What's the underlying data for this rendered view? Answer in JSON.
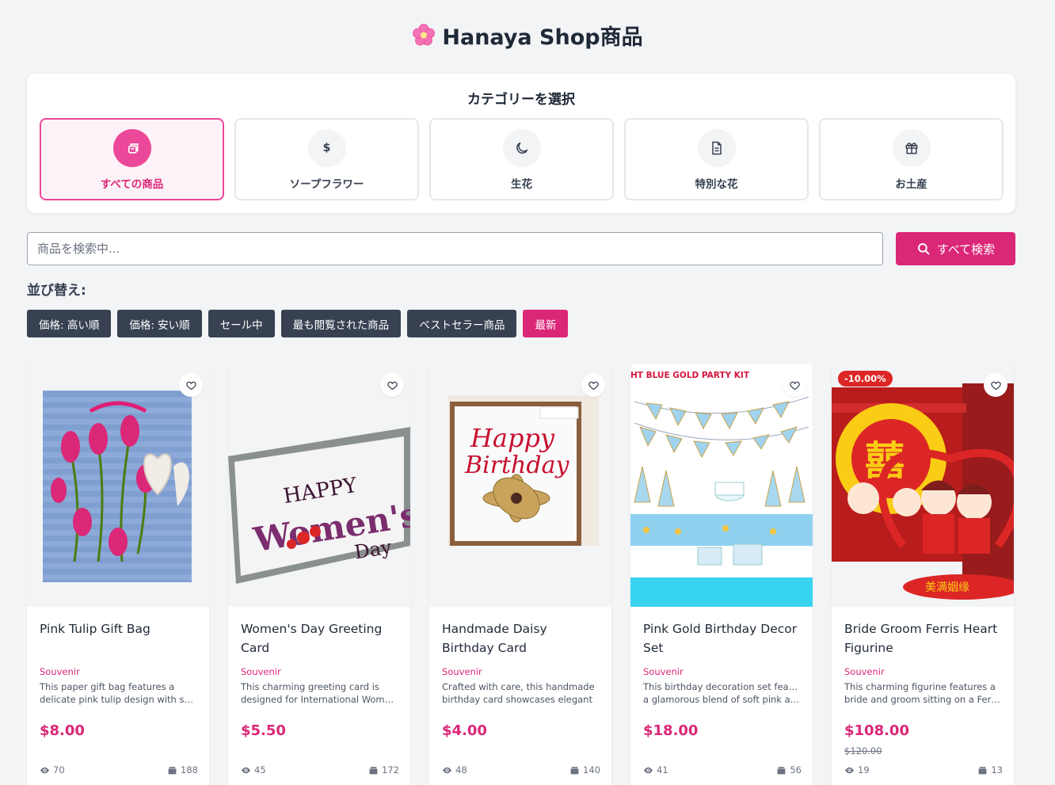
{
  "header": {
    "title": "Hanaya Shop商品",
    "logo_icon": "cherry-blossom-icon"
  },
  "categories": {
    "heading": "カテゴリーを選択",
    "items": [
      {
        "label": "すべての商品",
        "icon": "boxes-icon",
        "active": true
      },
      {
        "label": "ソープフラワー",
        "icon": "dollar-icon",
        "active": false
      },
      {
        "label": "生花",
        "icon": "moon-icon",
        "active": false
      },
      {
        "label": "特別な花",
        "icon": "document-icon",
        "active": false
      },
      {
        "label": "お土産",
        "icon": "gift-icon",
        "active": false
      }
    ]
  },
  "search": {
    "placeholder": "商品を検索中...",
    "value": "",
    "button_label": "すべて検索"
  },
  "sort": {
    "label": "並び替え:",
    "options": [
      {
        "label": "価格: 高い順",
        "active": false
      },
      {
        "label": "価格: 安い順",
        "active": false
      },
      {
        "label": "セール中",
        "active": false
      },
      {
        "label": "最も閲覧された商品",
        "active": false
      },
      {
        "label": "ベストセラー商品",
        "active": false
      },
      {
        "label": "最新",
        "active": true
      }
    ]
  },
  "products": [
    {
      "name": "Pink Tulip Gift Bag",
      "category": "Souvenir",
      "desc1": "This paper gift bag features a",
      "desc2": "delicate pink tulip design with subtle",
      "price": "$8.00",
      "old_price": "",
      "badge": "",
      "views": "70",
      "stock": "188"
    },
    {
      "name": "Women's Day Greeting Card",
      "category": "Souvenir",
      "desc1": "This charming greeting card is",
      "desc2": "designed for International Women's Day",
      "price": "$5.50",
      "old_price": "",
      "badge": "",
      "views": "45",
      "stock": "172"
    },
    {
      "name": "Handmade Daisy Birthday Card",
      "category": "Souvenir",
      "desc1": "Crafted with care, this handmade",
      "desc2": "birthday card showcases elegant",
      "price": "$4.00",
      "old_price": "",
      "badge": "",
      "views": "48",
      "stock": "140"
    },
    {
      "name": "Pink Gold Birthday Decor Set",
      "category": "Souvenir",
      "desc1": "This birthday decoration set features",
      "desc2": "a glamorous blend of soft pink and gold",
      "price": "$18.00",
      "old_price": "",
      "badge": "",
      "views": "41",
      "stock": "56",
      "image_banner": "HT BLUE GOLD PARTY KIT"
    },
    {
      "name": "Bride Groom Ferris Heart Figurine",
      "category": "Souvenir",
      "desc1": "This charming figurine features a",
      "desc2": "bride and groom sitting on a Ferris wheel",
      "price": "$108.00",
      "old_price": "$120.00",
      "badge": "-10.00%",
      "views": "19",
      "stock": "13"
    }
  ],
  "colors": {
    "accent": "#db2777",
    "dark_button": "#374151",
    "badge": "#dc2626"
  }
}
